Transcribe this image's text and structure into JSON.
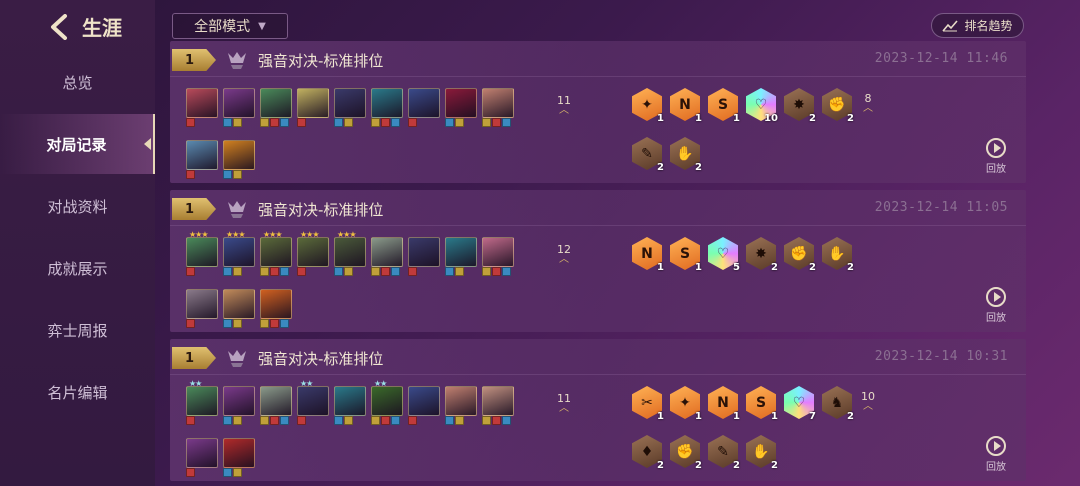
{
  "header": {
    "title": "生涯",
    "back_icon": "chevron-left-icon"
  },
  "sidebar": {
    "items": [
      {
        "label": "总览",
        "active": false
      },
      {
        "label": "对局记录",
        "active": true
      },
      {
        "label": "对战资料",
        "active": false
      },
      {
        "label": "成就展示",
        "active": false
      },
      {
        "label": "弈士周报",
        "active": false
      },
      {
        "label": "名片编辑",
        "active": false
      }
    ]
  },
  "filters": {
    "mode_select": "全部模式",
    "trend_button": "排名趋势"
  },
  "colors": {
    "accent_gold": "#e0c070",
    "trait_gold": "#ff9a3a",
    "trait_bronze": "#7a5a44",
    "bg": "#3b1a4c"
  },
  "matches": [
    {
      "rank": "1",
      "mode": "强音对决-标准排位",
      "date": "2023-12-14 11:46",
      "level": "11",
      "row1_champs": [
        {
          "color": "#b84a5a",
          "stars": ""
        },
        {
          "color": "#7a3a8a",
          "stars": ""
        },
        {
          "color": "#4a8a5a",
          "stars": ""
        },
        {
          "color": "#c0b060",
          "stars": ""
        },
        {
          "color": "#3a3a6a",
          "stars": ""
        },
        {
          "color": "#2a7a8a",
          "stars": ""
        },
        {
          "color": "#3a4a8a",
          "stars": ""
        },
        {
          "color": "#8a1a3a",
          "stars": ""
        },
        {
          "color": "#c08070",
          "stars": ""
        }
      ],
      "row2_champs": [
        {
          "color": "#5a8ab0",
          "stars": ""
        },
        {
          "color": "#d08020",
          "stars": ""
        }
      ],
      "traits_row1": [
        {
          "style": "gold",
          "glyph": "✦",
          "count": "1"
        },
        {
          "style": "gold",
          "glyph": "N",
          "count": "1"
        },
        {
          "style": "gold",
          "glyph": "S",
          "count": "1"
        },
        {
          "style": "prism",
          "glyph": "♡",
          "count": "10"
        },
        {
          "style": "bronze",
          "glyph": "✸",
          "count": "2"
        },
        {
          "style": "bronze",
          "glyph": "✊",
          "count": "2"
        }
      ],
      "traits_count": "8",
      "traits_row2": [
        {
          "style": "bronze",
          "glyph": "✎",
          "count": "2"
        },
        {
          "style": "bronze",
          "glyph": "✋",
          "count": "2"
        }
      ],
      "replay_label": "回放"
    },
    {
      "rank": "1",
      "mode": "强音对决-标准排位",
      "date": "2023-12-14 11:05",
      "level": "12",
      "row1_champs": [
        {
          "color": "#4a8a5a",
          "stars": "★★★"
        },
        {
          "color": "#3a4a8a",
          "stars": "★★★"
        },
        {
          "color": "#5a6a3a",
          "stars": "★★★"
        },
        {
          "color": "#5a6a3a",
          "stars": "★★★"
        },
        {
          "color": "#4a5a3a",
          "stars": "★★★"
        },
        {
          "color": "#8a9a8a",
          "stars": ""
        },
        {
          "color": "#3a3a6a",
          "stars": ""
        },
        {
          "color": "#2a7a8a",
          "stars": ""
        },
        {
          "color": "#c06a8a",
          "stars": ""
        }
      ],
      "row2_champs": [
        {
          "color": "#8a7a8a",
          "stars": ""
        },
        {
          "color": "#c08a5a",
          "stars": ""
        },
        {
          "color": "#d06020",
          "stars": ""
        }
      ],
      "traits_row1": [
        {
          "style": "gold",
          "glyph": "N",
          "count": "1"
        },
        {
          "style": "gold",
          "glyph": "S",
          "count": "1"
        },
        {
          "style": "prism",
          "glyph": "♡",
          "count": "5"
        },
        {
          "style": "bronze",
          "glyph": "✸",
          "count": "2"
        },
        {
          "style": "bronze",
          "glyph": "✊",
          "count": "2"
        },
        {
          "style": "bronze",
          "glyph": "✋",
          "count": "2"
        }
      ],
      "traits_count": "",
      "traits_row2": [],
      "replay_label": "回放"
    },
    {
      "rank": "1",
      "mode": "强音对决-标准排位",
      "date": "2023-12-14 10:31",
      "level": "11",
      "row1_champs": [
        {
          "color": "#4a8a5a",
          "stars": "★★"
        },
        {
          "color": "#7a3a8a",
          "stars": ""
        },
        {
          "color": "#8a9a8a",
          "stars": ""
        },
        {
          "color": "#3a3a6a",
          "stars": "★★"
        },
        {
          "color": "#2a7a8a",
          "stars": ""
        },
        {
          "color": "#3a6a2a",
          "stars": "★★"
        },
        {
          "color": "#3a4a8a",
          "stars": ""
        },
        {
          "color": "#c08070",
          "stars": ""
        },
        {
          "color": "#c09080",
          "stars": ""
        }
      ],
      "row2_champs": [
        {
          "color": "#7a3a8a",
          "stars": ""
        },
        {
          "color": "#b02a2a",
          "stars": ""
        }
      ],
      "traits_row1": [
        {
          "style": "gold",
          "glyph": "✂",
          "count": "1"
        },
        {
          "style": "gold",
          "glyph": "✦",
          "count": "1"
        },
        {
          "style": "gold",
          "glyph": "N",
          "count": "1"
        },
        {
          "style": "gold",
          "glyph": "S",
          "count": "1"
        },
        {
          "style": "prism",
          "glyph": "♡",
          "count": "7"
        },
        {
          "style": "bronze",
          "glyph": "♞",
          "count": "2"
        }
      ],
      "traits_count": "10",
      "traits_row2": [
        {
          "style": "bronze",
          "glyph": "♦",
          "count": "2"
        },
        {
          "style": "bronze",
          "glyph": "✊",
          "count": "2"
        },
        {
          "style": "bronze",
          "glyph": "✎",
          "count": "2"
        },
        {
          "style": "bronze",
          "glyph": "✋",
          "count": "2"
        }
      ],
      "replay_label": "回放"
    }
  ]
}
